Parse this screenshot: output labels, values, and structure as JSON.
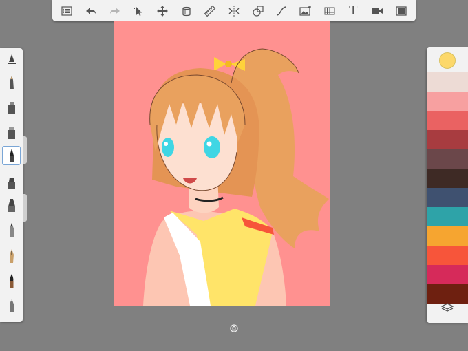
{
  "toolbar": {
    "items": [
      "menu-icon",
      "undo-icon",
      "redo-icon",
      "select-icon",
      "transform-icon",
      "ruler-icon",
      "eraser-tool-icon",
      "symmetry-icon",
      "shape-icon",
      "curve-icon",
      "image-insert-icon",
      "perspective-grid-icon",
      "text-icon",
      "video-icon",
      "fullscreen-icon"
    ],
    "text_label": "T"
  },
  "brushes": [
    "pencil",
    "ballpoint-pen",
    "marker",
    "airbrush",
    "paintbrush",
    "smudge",
    "felt-tip",
    "fine-pen",
    "fountain-pen",
    "ink-brush",
    "eraser"
  ],
  "selected_brush": "paintbrush",
  "colors": {
    "current": "#fcd86a",
    "palette": [
      "#eddbd5",
      "#f7a0a0",
      "#ea6262",
      "#a83c40",
      "#6b474a",
      "#3e2a25",
      "#3f5170",
      "#2ea3a8",
      "#f6a530",
      "#f7553a",
      "#d62a5a",
      "#6e2010"
    ]
  },
  "canvas": {
    "background": "#ff9190"
  }
}
